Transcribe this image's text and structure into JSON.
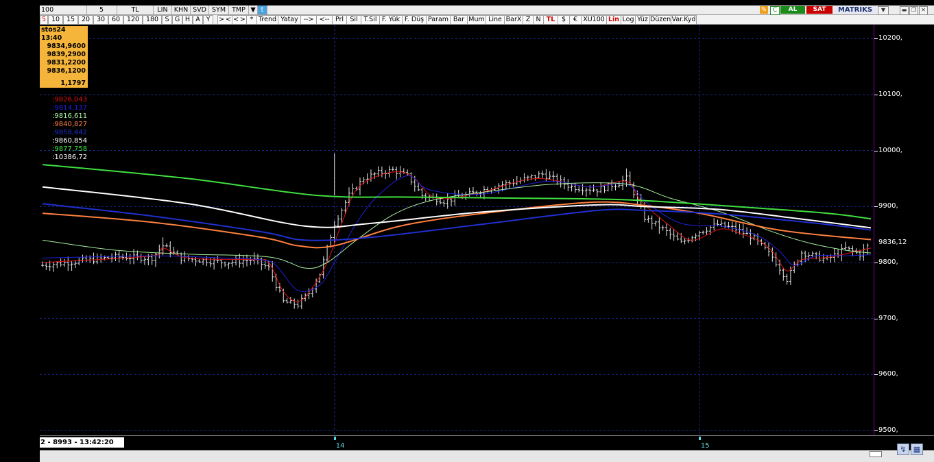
{
  "toolbar1": {
    "symbol": "100",
    "period": "5",
    "currency": "TL",
    "scale": "LIN",
    "items": [
      "KHN",
      "SVD",
      "SYM",
      "TMP"
    ],
    "al": "AL",
    "sat": "SAT",
    "logo": "MATRIKS"
  },
  "toolbar2": {
    "periods": [
      "5",
      "10",
      "15",
      "20",
      "30",
      "60",
      "120",
      "180",
      "S",
      "G",
      "H",
      "A",
      "Y"
    ],
    "buttons": [
      "> <",
      "< >",
      "*",
      "Trend",
      "Yatay",
      "-->",
      "<--",
      "Prl",
      "Sil",
      "T.Sil",
      "F. Yük",
      "F. Düş",
      "Param",
      "Bar",
      "Mum",
      "Line",
      "BarX",
      "Z",
      "N",
      "TL",
      "$",
      "€",
      "XU100",
      "Lin",
      "Log",
      "Yüz",
      "Düzen",
      "Var.Kyd"
    ]
  },
  "info_box": {
    "date": "stos24 13:40",
    "open": "9834,9600",
    "high": "9839,2900",
    "low": "9831,2200",
    "close": "9836,1200",
    "change": "1,1797"
  },
  "indicators": [
    {
      "text": ":9826,043",
      "color": "#e01010"
    },
    {
      "text": ":9814,137",
      "color": "#2020e0"
    },
    {
      "text": ":9816,611",
      "color": "#a8f0a0"
    },
    {
      "text": ":9840,827",
      "color": "#ff8040"
    },
    {
      "text": ":9858,442",
      "color": "#2030d0"
    },
    {
      "text": ":9860,854",
      "color": "#ffffff"
    },
    {
      "text": ":9877,758",
      "color": "#40e040"
    },
    {
      "text": ":10386,72",
      "color": "#ffffff"
    }
  ],
  "y_axis": {
    "ticks": [
      {
        "label": "10200,",
        "value": 10200
      },
      {
        "label": "10100,",
        "value": 10100
      },
      {
        "label": "10000,",
        "value": 10000
      },
      {
        "label": "9900,",
        "value": 9900
      },
      {
        "label": "9800,",
        "value": 9800
      },
      {
        "label": "9700,",
        "value": 9700
      },
      {
        "label": "9600,",
        "value": 9600
      },
      {
        "label": "9500,",
        "value": 9500
      }
    ],
    "last_price": "9836,12",
    "last_value": 9836.12
  },
  "x_axis": {
    "clock": "2 - 8993 - 13:42:20",
    "day_labels": [
      {
        "label": "14",
        "bar": 80
      },
      {
        "label": "15",
        "bar": 180
      }
    ]
  },
  "chart_data": {
    "type": "line",
    "ylim": [
      9500,
      10220
    ],
    "grid": true,
    "bar_count": 227,
    "close_anchors": [
      [
        0,
        9795
      ],
      [
        20,
        9810
      ],
      [
        30,
        9808
      ],
      [
        33,
        9830
      ],
      [
        38,
        9808
      ],
      [
        50,
        9800
      ],
      [
        58,
        9805
      ],
      [
        62,
        9790
      ],
      [
        66,
        9730
      ],
      [
        70,
        9725
      ],
      [
        73,
        9745
      ],
      [
        76,
        9780
      ],
      [
        80,
        9870
      ],
      [
        84,
        9920
      ],
      [
        88,
        9950
      ],
      [
        92,
        9960
      ],
      [
        96,
        9965
      ],
      [
        100,
        9955
      ],
      [
        104,
        9920
      ],
      [
        110,
        9910
      ],
      [
        115,
        9918
      ],
      [
        125,
        9938
      ],
      [
        130,
        9945
      ],
      [
        137,
        9958
      ],
      [
        145,
        9935
      ],
      [
        152,
        9930
      ],
      [
        158,
        9942
      ],
      [
        160,
        9950
      ],
      [
        162,
        9925
      ],
      [
        165,
        9880
      ],
      [
        170,
        9860
      ],
      [
        175,
        9835
      ],
      [
        180,
        9855
      ],
      [
        185,
        9868
      ],
      [
        190,
        9860
      ],
      [
        195,
        9843
      ],
      [
        200,
        9810
      ],
      [
        204,
        9770
      ],
      [
        208,
        9818
      ],
      [
        215,
        9805
      ],
      [
        220,
        9825
      ],
      [
        224,
        9815
      ],
      [
        227,
        9836
      ]
    ],
    "series": [
      {
        "color": "#e01010",
        "points": [
          [
            0,
            9800
          ],
          [
            30,
            9812
          ],
          [
            33,
            9826
          ],
          [
            40,
            9808
          ],
          [
            58,
            9805
          ],
          [
            62,
            9800
          ],
          [
            66,
            9748
          ],
          [
            70,
            9730
          ],
          [
            74,
            9755
          ],
          [
            78,
            9800
          ],
          [
            82,
            9870
          ],
          [
            86,
            9930
          ],
          [
            92,
            9955
          ],
          [
            98,
            9962
          ],
          [
            102,
            9950
          ],
          [
            108,
            9915
          ],
          [
            120,
            9925
          ],
          [
            135,
            9950
          ],
          [
            150,
            9935
          ],
          [
            160,
            9945
          ],
          [
            164,
            9910
          ],
          [
            172,
            9865
          ],
          [
            178,
            9840
          ],
          [
            186,
            9860
          ],
          [
            192,
            9850
          ],
          [
            196,
            9840
          ],
          [
            200,
            9820
          ],
          [
            204,
            9785
          ],
          [
            208,
            9805
          ],
          [
            216,
            9810
          ],
          [
            227,
            9826
          ]
        ]
      },
      {
        "color": "#2020e0",
        "points": [
          [
            0,
            9808
          ],
          [
            30,
            9812
          ],
          [
            50,
            9808
          ],
          [
            60,
            9805
          ],
          [
            64,
            9795
          ],
          [
            70,
            9750
          ],
          [
            76,
            9760
          ],
          [
            80,
            9800
          ],
          [
            86,
            9870
          ],
          [
            92,
            9920
          ],
          [
            100,
            9955
          ],
          [
            106,
            9930
          ],
          [
            120,
            9922
          ],
          [
            138,
            9945
          ],
          [
            150,
            9935
          ],
          [
            160,
            9940
          ],
          [
            166,
            9905
          ],
          [
            175,
            9870
          ],
          [
            186,
            9865
          ],
          [
            196,
            9848
          ],
          [
            202,
            9820
          ],
          [
            206,
            9795
          ],
          [
            212,
            9812
          ],
          [
            220,
            9812
          ],
          [
            227,
            9814
          ]
        ]
      },
      {
        "color": "#a8f0a0",
        "points": [
          [
            0,
            9840
          ],
          [
            20,
            9822
          ],
          [
            40,
            9815
          ],
          [
            62,
            9810
          ],
          [
            72,
            9790
          ],
          [
            78,
            9800
          ],
          [
            86,
            9840
          ],
          [
            96,
            9885
          ],
          [
            106,
            9910
          ],
          [
            120,
            9925
          ],
          [
            140,
            9940
          ],
          [
            160,
            9940
          ],
          [
            172,
            9915
          ],
          [
            186,
            9890
          ],
          [
            200,
            9855
          ],
          [
            210,
            9835
          ],
          [
            220,
            9822
          ],
          [
            227,
            9817
          ]
        ]
      },
      {
        "color": "#ff8040",
        "points": [
          [
            0,
            9888
          ],
          [
            30,
            9872
          ],
          [
            60,
            9845
          ],
          [
            70,
            9830
          ],
          [
            80,
            9830
          ],
          [
            100,
            9868
          ],
          [
            130,
            9895
          ],
          [
            152,
            9908
          ],
          [
            165,
            9902
          ],
          [
            180,
            9888
          ],
          [
            200,
            9860
          ],
          [
            215,
            9848
          ],
          [
            227,
            9841
          ]
        ]
      },
      {
        "color": "#2030d0",
        "points": [
          [
            0,
            9905
          ],
          [
            30,
            9883
          ],
          [
            60,
            9855
          ],
          [
            72,
            9840
          ],
          [
            90,
            9845
          ],
          [
            120,
            9868
          ],
          [
            152,
            9893
          ],
          [
            165,
            9893
          ],
          [
            185,
            9887
          ],
          [
            200,
            9878
          ],
          [
            215,
            9868
          ],
          [
            227,
            9858
          ]
        ]
      },
      {
        "color": "#ffffff",
        "points": [
          [
            0,
            9935
          ],
          [
            40,
            9905
          ],
          [
            72,
            9865
          ],
          [
            90,
            9870
          ],
          [
            120,
            9890
          ],
          [
            152,
            9903
          ],
          [
            165,
            9900
          ],
          [
            185,
            9895
          ],
          [
            205,
            9880
          ],
          [
            227,
            9862
          ]
        ]
      },
      {
        "color": "#40e040",
        "points": [
          [
            0,
            9975
          ],
          [
            40,
            9950
          ],
          [
            75,
            9920
          ],
          [
            100,
            9917
          ],
          [
            130,
            9915
          ],
          [
            160,
            9912
          ],
          [
            190,
            9900
          ],
          [
            215,
            9888
          ],
          [
            227,
            9878
          ]
        ]
      }
    ]
  }
}
